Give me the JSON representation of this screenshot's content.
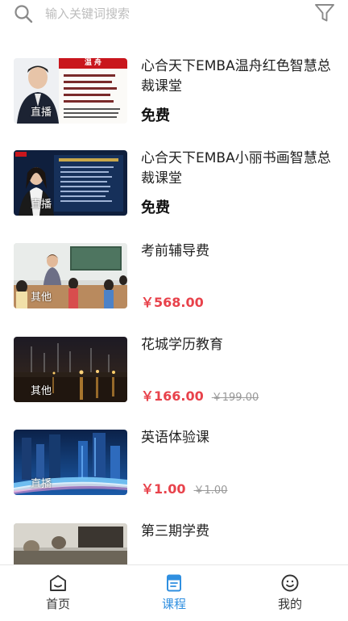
{
  "search": {
    "placeholder": "输入关键词搜索"
  },
  "icons": {
    "search": "search-icon",
    "filter": "filter-icon",
    "home": "home-icon",
    "courses": "course-book-icon",
    "me": "smiley-icon"
  },
  "colors": {
    "price_red": "#e8424b",
    "active_tab_blue": "#2f8fe0",
    "free_black": "#111111"
  },
  "courses": [
    {
      "title": "心合天下EMBA温舟红色智慧总裁课堂",
      "tag": "直播",
      "banner": "温 舟",
      "price": "免费",
      "original_price": ""
    },
    {
      "title": "心合天下EMBA小丽书画智慧总裁课堂",
      "tag": "直播",
      "banner": "",
      "price": "免费",
      "original_price": ""
    },
    {
      "title": "考前辅导费",
      "tag": "其他",
      "banner": "",
      "price": "￥568.00",
      "original_price": ""
    },
    {
      "title": "花城学历教育",
      "tag": "其他",
      "banner": "",
      "price": "￥166.00",
      "original_price": "￥199.00"
    },
    {
      "title": "英语体验课",
      "tag": "直播",
      "banner": "",
      "price": "￥1.00",
      "original_price": "￥1.00"
    },
    {
      "title": "第三期学费",
      "tag": "",
      "banner": "",
      "price": "",
      "original_price": ""
    }
  ],
  "tabs": [
    {
      "label": "首页",
      "icon": "home-icon",
      "active": false
    },
    {
      "label": "课程",
      "icon": "course-book-icon",
      "active": true
    },
    {
      "label": "我的",
      "icon": "smiley-icon",
      "active": false
    }
  ]
}
